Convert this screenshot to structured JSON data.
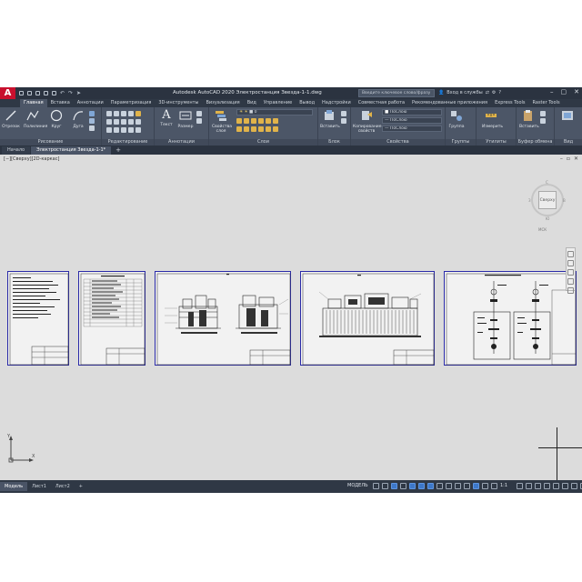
{
  "title_bar": {
    "logo": "A",
    "title": "Autodesk AutoCAD 2020   Электростанция Звезда-1-1.dwg",
    "search_placeholder": "Введите ключевое слово/фразу",
    "user": "Вход в службы",
    "help": "?"
  },
  "ribbon_tabs": [
    "Главная",
    "Вставка",
    "Аннотации",
    "Параметризация",
    "3D-инструменты",
    "Визуализация",
    "Вид",
    "Управление",
    "Вывод",
    "Надстройки",
    "Совместная работа",
    "Рекомендованные приложения",
    "Express Tools",
    "Raster Tools"
  ],
  "active_ribbon_tab": 0,
  "ribbon": {
    "draw": {
      "label": "Рисование",
      "tools": [
        "Отрезок",
        "Полилиния",
        "Круг",
        "Дуга"
      ]
    },
    "modify": {
      "label": "Редактирование"
    },
    "annotation": {
      "label": "Аннотации",
      "tools": [
        "Текст",
        "Размер"
      ]
    },
    "layers": {
      "label": "Слои",
      "tools": [
        "Свойства слоя"
      ],
      "layer_value": "0"
    },
    "block": {
      "label": "Блок",
      "tools": [
        "Вставить"
      ]
    },
    "properties": {
      "label": "Свойства",
      "tools": [
        "Копирование свойств"
      ],
      "color": "ПоСлою",
      "linetype": "ПоСлою",
      "lineweight": "ПоСлою"
    },
    "groups": {
      "label": "Группы",
      "tools": [
        "Группа"
      ]
    },
    "utilities": {
      "label": "Утилиты",
      "tools": [
        "Измерить"
      ]
    },
    "clipboard": {
      "label": "Буфер обмена",
      "tools": [
        "Вставить"
      ]
    },
    "view": {
      "label": "Вид"
    }
  },
  "file_tabs": [
    "Начало",
    "Электростанция Звезда-1-1*"
  ],
  "active_file_tab": 1,
  "canvas": {
    "view_label": "[−][Сверху][2D-каркас]",
    "viewcube_face": "Сверху",
    "viewcube_dirs": {
      "n": "С",
      "s": "Ю",
      "e": "В",
      "w": "З"
    },
    "wcs": "МСК"
  },
  "layout_tabs": [
    "Модель",
    "Лист1",
    "Лист2"
  ],
  "active_layout_tab": 0,
  "status": {
    "model": "МОДЕЛЬ",
    "scale": "1:1"
  },
  "colors": {
    "frame": "#3b4453",
    "canvas": "#dcdcdc",
    "sheet_border": "#2a2aa8",
    "accent": "#c8102e"
  }
}
